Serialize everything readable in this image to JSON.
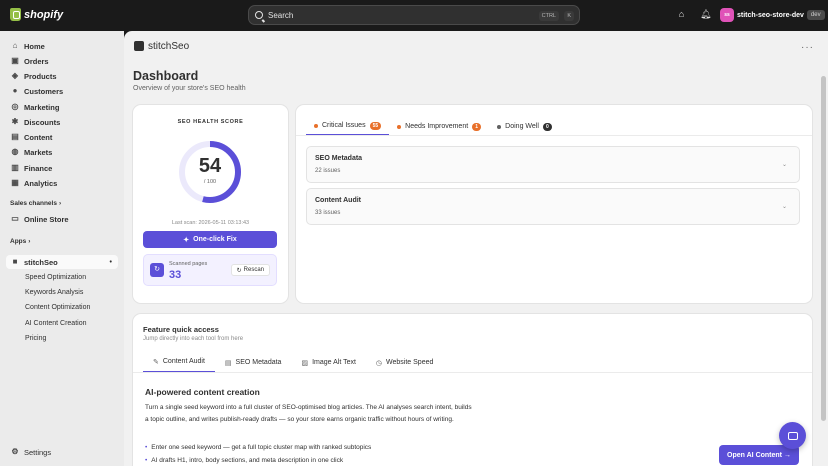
{
  "topbar": {
    "brand": "shopify",
    "search_placeholder": "Search",
    "shortcut_ctrl": "CTRL",
    "shortcut_key": "K",
    "store_initials": "ss",
    "store_name": "stitch-seo-store-dev",
    "store_badge": "dev"
  },
  "sidebar": {
    "items": [
      {
        "label": "Home",
        "icon": "home-icon"
      },
      {
        "label": "Orders",
        "icon": "orders-icon"
      },
      {
        "label": "Products",
        "icon": "tag-icon"
      },
      {
        "label": "Customers",
        "icon": "person-icon"
      },
      {
        "label": "Marketing",
        "icon": "target-icon"
      },
      {
        "label": "Discounts",
        "icon": "discount-icon"
      },
      {
        "label": "Content",
        "icon": "content-icon"
      },
      {
        "label": "Markets",
        "icon": "globe-icon"
      },
      {
        "label": "Finance",
        "icon": "bank-icon"
      },
      {
        "label": "Analytics",
        "icon": "chart-icon"
      }
    ],
    "sales_channels_label": "Sales channels",
    "online_store_label": "Online Store",
    "apps_label": "Apps",
    "app_name": "stitchSeo",
    "app_subitems": [
      "Speed Optimization",
      "Keywords Analysis",
      "Content Optimization",
      "AI Content Creation",
      "Pricing"
    ],
    "settings_label": "Settings"
  },
  "app_header": {
    "title": "stitchSeo"
  },
  "page": {
    "title": "Dashboard",
    "subtitle": "Overview of your store's SEO health"
  },
  "score_card": {
    "label": "SEO HEALTH SCORE",
    "score": "54",
    "max": "/ 100",
    "score_fraction": 0.54,
    "last_scan": "Last scan: 2026-05-11 03:13:43",
    "fix_button": "One-click Fix",
    "scanned_label": "Scanned pages",
    "scanned_value": "33",
    "rescan_label": "Rescan"
  },
  "issues": {
    "tabs": [
      {
        "label": "Critical Issues",
        "count": "55",
        "dot": "#e8702a",
        "badge": "#e8702a"
      },
      {
        "label": "Needs Improvement",
        "count": "1",
        "dot": "#e8702a",
        "badge": "#e8702a"
      },
      {
        "label": "Doing Well",
        "count": "0",
        "dot": "#616161",
        "badge": "#303030"
      }
    ],
    "rows": [
      {
        "title": "SEO Metadata",
        "count": "22 issues"
      },
      {
        "title": "Content Audit",
        "count": "33 issues"
      }
    ]
  },
  "quick_access": {
    "title": "Feature quick access",
    "subtitle": "Jump directly into each tool from here",
    "tabs": [
      "Content Audit",
      "SEO Metadata",
      "Image Alt Text",
      "Website Speed"
    ],
    "feature_title": "AI-powered content creation",
    "feature_desc": "Turn a single seed keyword into a full cluster of SEO-optimised blog articles. The AI analyses search intent, builds a topic outline, and writes publish-ready drafts — so your store earns organic traffic without hours of writing.",
    "bullets": [
      "Enter one seed keyword — get a full topic cluster map with ranked subtopics",
      "AI drafts H1, intro, body sections, and meta description in one click"
    ],
    "open_button": "Open AI Content →"
  },
  "colors": {
    "accent": "#5b4fd8",
    "warning": "#e8702a"
  }
}
